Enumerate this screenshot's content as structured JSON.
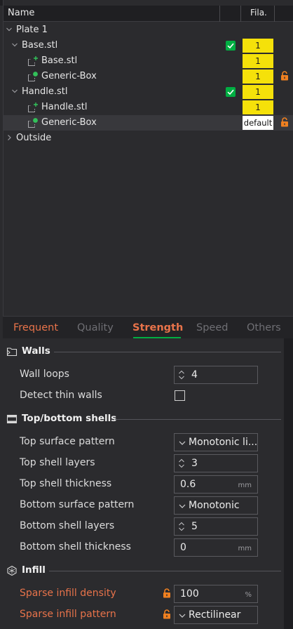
{
  "object_list": {
    "header": {
      "name_col": "Name",
      "fila_col": "Fila."
    },
    "rows": [
      {
        "label": "Plate 1",
        "indent": 0,
        "expanded": true,
        "type": "plate",
        "checkbox": false,
        "filament": "",
        "locked": false,
        "selected": false
      },
      {
        "label": "Base.stl",
        "indent": 1,
        "expanded": true,
        "type": "object",
        "checkbox": true,
        "filament": "1",
        "locked": false,
        "selected": false
      },
      {
        "label": "Base.stl",
        "indent": 2,
        "type": "part",
        "checkbox": false,
        "filament": "1",
        "locked": false,
        "selected": false
      },
      {
        "label": "Generic-Box",
        "indent": 2,
        "type": "modifier",
        "checkbox": false,
        "filament": "1",
        "locked": true,
        "selected": false
      },
      {
        "label": "Handle.stl",
        "indent": 1,
        "expanded": true,
        "type": "object",
        "checkbox": true,
        "filament": "1",
        "locked": false,
        "selected": false
      },
      {
        "label": "Handle.stl",
        "indent": 2,
        "type": "part",
        "checkbox": false,
        "filament": "1",
        "locked": false,
        "selected": false
      },
      {
        "label": "Generic-Box",
        "indent": 2,
        "type": "modifier",
        "checkbox": false,
        "filament": "default",
        "locked": true,
        "selected": true
      },
      {
        "label": "Outside",
        "indent": 0,
        "expanded": false,
        "type": "plate",
        "checkbox": false,
        "filament": "",
        "locked": false,
        "selected": false
      }
    ]
  },
  "tabs": [
    {
      "label": "Frequent",
      "state": "modified"
    },
    {
      "label": "Quality",
      "state": "inactive"
    },
    {
      "label": "Strength",
      "state": "active"
    },
    {
      "label": "Speed",
      "state": "inactive"
    },
    {
      "label": "Others",
      "state": "inactive"
    }
  ],
  "sections": {
    "walls": {
      "title": "Walls",
      "icon": "walls-icon",
      "wall_loops": {
        "label": "Wall loops",
        "value": "4"
      },
      "detect_thin_walls": {
        "label": "Detect thin walls",
        "checked": false
      }
    },
    "top_bottom": {
      "title": "Top/bottom shells",
      "icon": "shells-icon",
      "top_surface_pattern": {
        "label": "Top surface pattern",
        "value": "Monotonic li..."
      },
      "top_shell_layers": {
        "label": "Top shell layers",
        "value": "3"
      },
      "top_shell_thickness": {
        "label": "Top shell thickness",
        "value": "0.6",
        "unit": "mm"
      },
      "bottom_surface_pattern": {
        "label": "Bottom surface pattern",
        "value": "Monotonic"
      },
      "bottom_shell_layers": {
        "label": "Bottom shell layers",
        "value": "5"
      },
      "bottom_shell_thickness": {
        "label": "Bottom shell thickness",
        "value": "0",
        "unit": "mm"
      }
    },
    "infill": {
      "title": "Infill",
      "icon": "infill-icon",
      "sparse_infill_density": {
        "label": "Sparse infill density",
        "value": "100",
        "unit": "%",
        "modified": true
      },
      "sparse_infill_pattern": {
        "label": "Sparse infill pattern",
        "value": "Rectilinear",
        "modified": true
      }
    }
  },
  "colors": {
    "accent_green": "#00ae42",
    "modified_orange": "#e8734a",
    "filament_yellow": "#f5e10a",
    "lock_orange": "#f08020"
  }
}
